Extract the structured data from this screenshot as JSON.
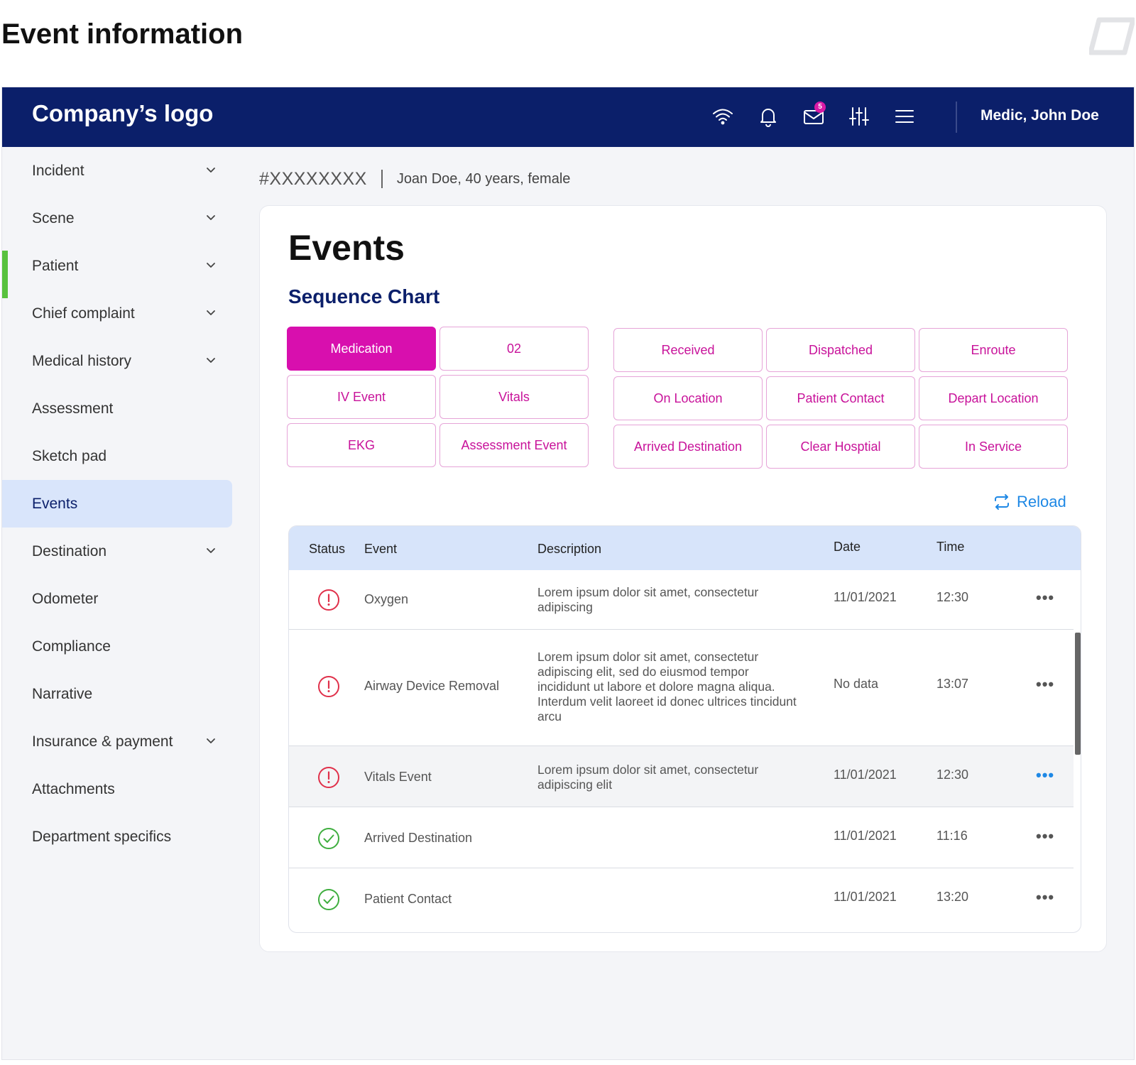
{
  "page": {
    "heading": "Event information"
  },
  "topbar": {
    "logo": "Company’s logo",
    "mail_badge": "5",
    "user": "Medic, John Doe",
    "icons": [
      "wifi-icon",
      "bell-icon",
      "mail-icon",
      "sliders-icon",
      "menu-icon"
    ]
  },
  "sidebar": {
    "items": [
      {
        "label": "Incident",
        "expandable": true
      },
      {
        "label": "Scene",
        "expandable": true
      },
      {
        "label": "Patient",
        "expandable": true
      },
      {
        "label": "Chief complaint",
        "expandable": true
      },
      {
        "label": "Medical history",
        "expandable": true
      },
      {
        "label": "Assessment",
        "expandable": false
      },
      {
        "label": "Sketch pad",
        "expandable": false
      },
      {
        "label": "Events",
        "expandable": false,
        "active": true
      },
      {
        "label": "Destination",
        "expandable": true
      },
      {
        "label": "Odometer",
        "expandable": false
      },
      {
        "label": "Compliance",
        "expandable": false
      },
      {
        "label": "Narrative",
        "expandable": false
      },
      {
        "label": "Insurance & payment",
        "expandable": true
      },
      {
        "label": "Attachments",
        "expandable": false
      },
      {
        "label": "Department specifics",
        "expandable": false
      }
    ]
  },
  "breadcrumb": {
    "case_id": "#XXXXXXXX",
    "patient": "Joan Doe, 40 years, female"
  },
  "main": {
    "title": "Events",
    "section_title": "Sequence Chart",
    "buttons_left": [
      "Medication",
      "02",
      "IV Event",
      "Vitals",
      "EKG",
      "Assessment Event"
    ],
    "buttons_right": [
      "Received",
      "Dispatched",
      "Enroute",
      "On Location",
      "Patient Contact",
      "Depart Location",
      "Arrived Destination",
      "Clear Hosptial",
      "In Service"
    ],
    "active_button": "Medication",
    "reload_label": "Reload"
  },
  "table": {
    "headers": {
      "status": "Status",
      "event": "Event",
      "description": "Description",
      "date": "Date",
      "time": "Time"
    },
    "rows": [
      {
        "status": "warning",
        "event": "Oxygen",
        "description": "Lorem ipsum dolor sit amet, consectetur adipiscing",
        "date": "11/01/2021",
        "time": "12:30"
      },
      {
        "status": "warning",
        "event": "Airway Device Removal",
        "description": "Lorem ipsum dolor sit amet, consectetur adipiscing elit, sed do eiusmod tempor incididunt ut labore et dolore magna aliqua. Interdum velit laoreet id donec ultrices tincidunt arcu",
        "date": "No data",
        "time": "13:07"
      },
      {
        "status": "warning",
        "event": "Vitals Event",
        "description": "Lorem ipsum dolor sit amet, consectetur adipiscing elit",
        "date": "11/01/2021",
        "time": "12:30"
      },
      {
        "status": "ok",
        "event": "Arrived Destination",
        "description": "",
        "date": "11/01/2021",
        "time": "11:16"
      },
      {
        "status": "ok",
        "event": "Patient Contact",
        "description": "",
        "date": "11/01/2021",
        "time": "13:20"
      }
    ],
    "more_glyph": "•••"
  },
  "colors": {
    "topbar": "#0b1f6a",
    "accent_magenta": "#d80fae",
    "active_nav_bg": "#d9e5fb",
    "warning": "#e0304a",
    "ok": "#3fae3f",
    "link_blue": "#1e88e5"
  }
}
